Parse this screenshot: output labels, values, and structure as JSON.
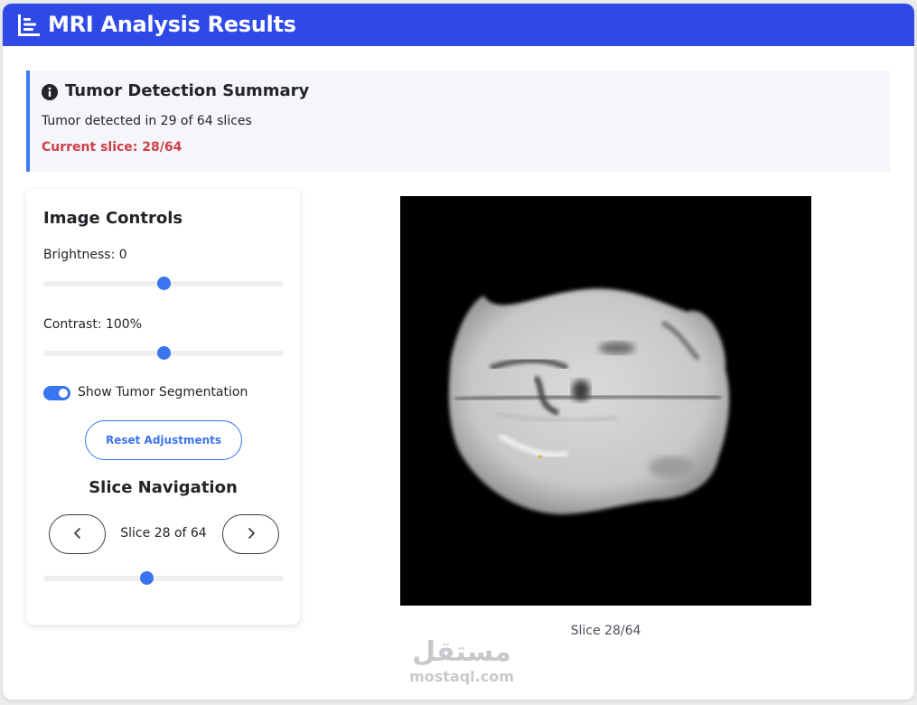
{
  "header": {
    "title": "MRI Analysis Results",
    "icon": "chart-bars-icon",
    "color": "#2f49e6"
  },
  "summary": {
    "icon": "info-circle-icon",
    "title": "Tumor Detection Summary",
    "text": "Tumor detected in 29 of 64 slices",
    "current_slice": "Current slice: 28/64",
    "accent_color": "#3a7bf0",
    "current_color": "#d04048"
  },
  "controls": {
    "title": "Image Controls",
    "brightness": {
      "label": "Brightness: 0",
      "value": 0,
      "level": 0.5
    },
    "contrast": {
      "label": "Contrast: 100%",
      "value": 100,
      "level": 0.5
    },
    "segmentation_toggle": {
      "label": "Show Tumor Segmentation",
      "on": true
    },
    "reset_label": "Reset Adjustments",
    "accent_color": "#3b74f0"
  },
  "navigation": {
    "title": "Slice Navigation",
    "prev_icon": "chevron-left-icon",
    "next_icon": "chevron-right-icon",
    "slice_text": "Slice 28 of 64",
    "current": 28,
    "total": 64,
    "level": 0.43
  },
  "viewer": {
    "caption": "Slice 28/64"
  },
  "watermark": {
    "arabic": "مستقل",
    "latin": "mostaql.com"
  }
}
